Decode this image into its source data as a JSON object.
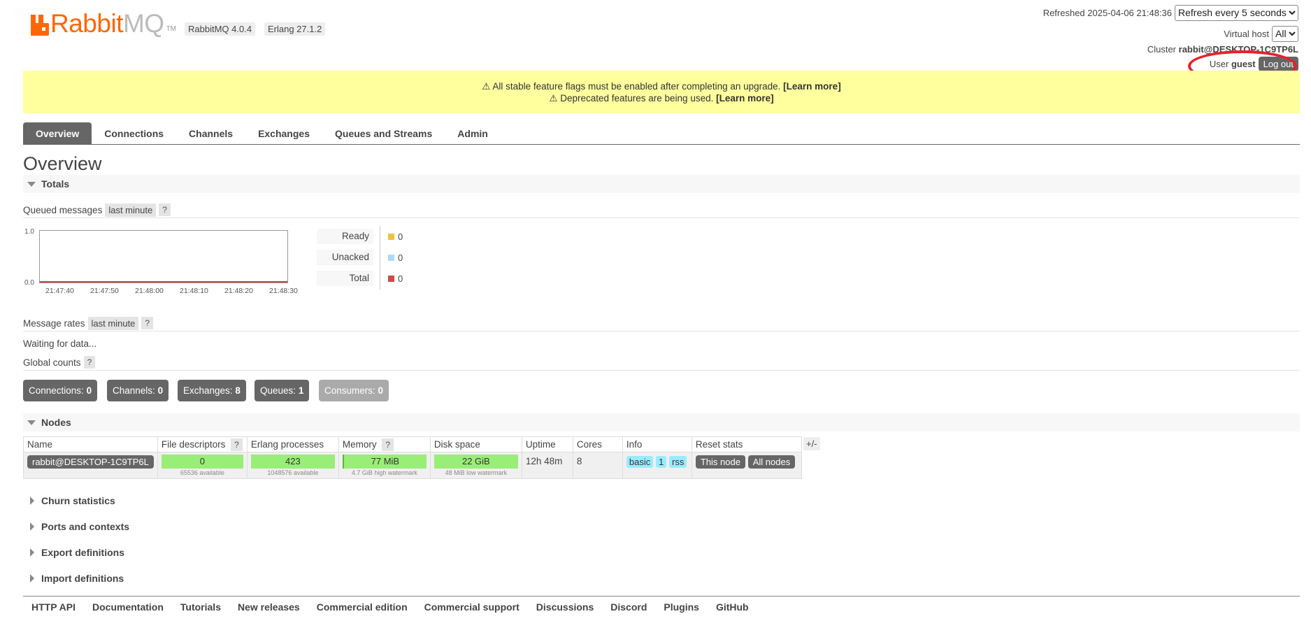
{
  "header": {
    "logo_primary": "Rabbit",
    "logo_secondary": "MQ",
    "logo_tm": "TM",
    "version": "RabbitMQ 4.0.4",
    "erlang": "Erlang 27.1.2",
    "refreshed_label": "Refreshed 2025-04-06 21:48:36",
    "refresh_option": "Refresh every 5 seconds",
    "vhost_label": "Virtual host",
    "vhost_option": "All",
    "cluster_label": "Cluster",
    "cluster_name": "rabbit@DESKTOP-1C9TP6L",
    "user_label": "User",
    "user_name": "guest",
    "logout_label": "Log out"
  },
  "banner": {
    "line1_text": "⚠ All stable feature flags must be enabled after completing an upgrade.",
    "line1_link": "[Learn more]",
    "line2_text": "⚠ Deprecated features are being used.",
    "line2_link": "[Learn more]"
  },
  "tabs": [
    {
      "label": "Overview"
    },
    {
      "label": "Connections"
    },
    {
      "label": "Channels"
    },
    {
      "label": "Exchanges"
    },
    {
      "label": "Queues and Streams"
    },
    {
      "label": "Admin"
    }
  ],
  "page_title": "Overview",
  "totals": {
    "section_label": "Totals",
    "queued_label": "Queued messages",
    "queued_range": "last minute",
    "help": "?",
    "chart_y_top": "1.0",
    "chart_y_bottom": "0.0",
    "chart_x_labels": [
      "21:47:40",
      "21:47:50",
      "21:48:00",
      "21:48:10",
      "21:48:20",
      "21:48:30"
    ],
    "legend": [
      {
        "label": "Ready",
        "value": "0",
        "color": "#edc240"
      },
      {
        "label": "Unacked",
        "value": "0",
        "color": "#afd8f8"
      },
      {
        "label": "Total",
        "value": "0",
        "color": "#cb4b4b"
      }
    ],
    "rates_label": "Message rates",
    "rates_range": "last minute",
    "waiting": "Waiting for data...",
    "global_label": "Global counts"
  },
  "counts": [
    {
      "label": "Connections:",
      "value": "0"
    },
    {
      "label": "Channels:",
      "value": "0"
    },
    {
      "label": "Exchanges:",
      "value": "8"
    },
    {
      "label": "Queues:",
      "value": "1"
    },
    {
      "label": "Consumers:",
      "value": "0"
    }
  ],
  "nodes": {
    "section_label": "Nodes",
    "columns": [
      "Name",
      "File descriptors",
      "Erlang processes",
      "Memory",
      "Disk space",
      "Uptime",
      "Cores",
      "Info",
      "Reset stats"
    ],
    "plusminus": "+/-",
    "row": {
      "name": "rabbit@DESKTOP-1C9TP6L",
      "fd": "0",
      "fd_sub": "65536 available",
      "procs": "423",
      "procs_sub": "1048576 available",
      "mem": "77 MiB",
      "mem_sub": "4.7 GiB high watermark",
      "disk": "22 GiB",
      "disk_sub": "48 MiB low watermark",
      "uptime": "12h 48m",
      "cores": "8",
      "info": [
        "basic",
        "1",
        "rss"
      ],
      "reset_this": "This node",
      "reset_all": "All nodes"
    }
  },
  "collapsed_sections": [
    "Churn statistics",
    "Ports and contexts",
    "Export definitions",
    "Import definitions"
  ],
  "footer": [
    "HTTP API",
    "Documentation",
    "Tutorials",
    "New releases",
    "Commercial edition",
    "Commercial support",
    "Discussions",
    "Discord",
    "Plugins",
    "GitHub"
  ]
}
